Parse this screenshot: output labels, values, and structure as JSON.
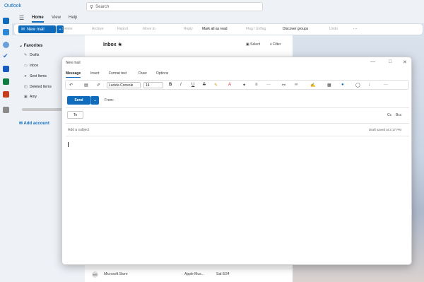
{
  "app": {
    "title": "Outlook",
    "search_placeholder": "Search"
  },
  "ribbon_tabs": [
    "Home",
    "View",
    "Help"
  ],
  "ribbon": {
    "new_mail": "New mail",
    "items": [
      "Delete",
      "Archive",
      "Report",
      "Move to",
      "Reply",
      "Mark all as read",
      "Flag / Unflag",
      "Discover groups",
      "Undo"
    ]
  },
  "folders": {
    "favorites": "Favorites",
    "items": [
      "Drafts",
      "Inbox",
      "Sent Items",
      "Deleted Items",
      "Amy"
    ],
    "add_account": "Add account"
  },
  "message_list": {
    "title": "Inbox",
    "select": "Select",
    "filter": "Filter",
    "bottom_row": {
      "initials": "MS",
      "sender": "Microsoft Store",
      "subject": "Apple Mus...",
      "date": "Sat 8/24"
    }
  },
  "dialog": {
    "title": "New mail",
    "tabs": [
      "Message",
      "Insert",
      "Format text",
      "Draw",
      "Options"
    ],
    "font_name": "Lucida Console",
    "font_size": "14",
    "send": "Send",
    "from_label": "From:",
    "to_label": "To",
    "cc": "Cc",
    "bcc": "Bcc",
    "subject_placeholder": "Add a subject",
    "draft_status": "Draft saved at 2:17 PM"
  },
  "colors": {
    "accent": "#0f6cbd",
    "rail_bg": "#eef2f7"
  }
}
